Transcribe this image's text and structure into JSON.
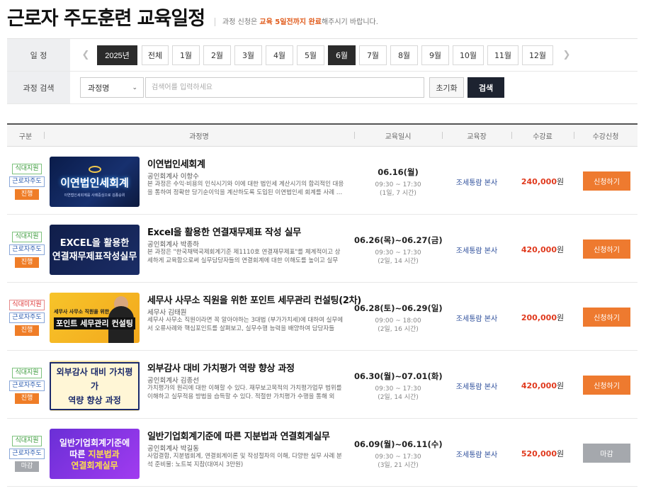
{
  "header": {
    "title": "근로자 주도훈련 교육일정",
    "notice_prefix": "과정 신청은 ",
    "notice_highlight": "교육 5일전까지 완료",
    "notice_suffix": "해주시기 바랍니다."
  },
  "filter": {
    "schedule_label": "일 정",
    "year": "2025년",
    "months": [
      "전체",
      "1월",
      "2월",
      "3월",
      "4월",
      "5월",
      "6월",
      "7월",
      "8월",
      "9월",
      "10월",
      "11월",
      "12월"
    ],
    "active_month": "6월",
    "search_label": "과정 검색",
    "select_value": "과정명",
    "search_placeholder": "검색어를 입력하세요",
    "reset_label": "초기화",
    "search_button": "검색"
  },
  "table": {
    "headers": [
      "구분",
      "과정명",
      "교육일시",
      "교육장",
      "수강료",
      "수강신청"
    ],
    "rows": [
      {
        "badges": [
          "식대지원",
          "근로자주도",
          "진행"
        ],
        "title": "이연법인세회계",
        "instructor": "공인회계사 이항수",
        "desc": "본 과정은 수익·비용의 인식시기와 이에 대한 법인세 계산시기의 합리적인 대응을 통하여 정확한 당기순이익을 계산하도록 도입된 이연법인세 회계를 사례 …",
        "thumb_main": "이연법인세회계",
        "thumb_sub": "이연법인세회계를 사례중심으로 김종승위",
        "date": "06.16(월)",
        "time": "09:30 ~ 17:30",
        "duration": "(1일, 7 시간)",
        "place": "조세통람 본사",
        "fee_num": "240,000",
        "fee_unit": "원",
        "apply": "신청하기"
      },
      {
        "badges": [
          "식대지원",
          "근로자주도",
          "진행"
        ],
        "title": "Excel을 활용한 연결재무제표 작성 실무",
        "instructor": "공인회계사 박종하",
        "desc": "본 과정은 \"한국채택국제회계기준 제1110호 연결재무제표\"를 체계적이고 상세하게 교육함으로써 실무담당자들의 연결회계에 대한 이해도를 높이고 실무처…",
        "thumb_line1": "EXCEL을 활용한",
        "thumb_line2": "연결재무제표작성실무",
        "date": "06.26(목)~06.27(금)",
        "time": "09:30 ~ 17:30",
        "duration": "(2일, 14 시간)",
        "place": "조세통람 본사",
        "fee_num": "420,000",
        "fee_unit": "원",
        "apply": "신청하기"
      },
      {
        "badges": [
          "식대미지원",
          "근로자주도",
          "진행"
        ],
        "title": "세무사 사무소 직원을 위한 포인트 세무관리 컨설팅(2차)",
        "instructor": "세무사 김태원",
        "desc": "세무사 사무소 직원이라면 꼭 알아야하는 3대법 (부가가치세)에 대하여 실무에서 오류사례와 핵심포인트를 살펴보고, 실무수행 능력을 배양하여 담당자들이…",
        "thumb_line0": "세무사 사무소  직원을 위한",
        "thumb_line1": "포인트 세무관리 컨설팅",
        "date": "06.28(토)~06.29(일)",
        "time": "09:00 ~ 18:00",
        "duration": "(2일, 16 시간)",
        "place": "조세통람 본사",
        "fee_num": "200,000",
        "fee_unit": "원",
        "apply": "신청하기"
      },
      {
        "badges": [
          "식대지원",
          "근로자주도",
          "진행"
        ],
        "title": "외부감사 대비 가치평가 역량 향상 과정",
        "instructor": "공인회계사 김종선",
        "desc": "가치평가의 원리에 대한 이해할 수 있다. 재무보고목적의 가치평가업무 범위를 이해하고 실무적용 방법을 습득할 수 있다. 적절한 가치평가 수행을 통해 외부…",
        "thumb_line1": "외부감사 대비 가치평가",
        "thumb_line2": "역량 향상 과정",
        "date": "06.30(월)~07.01(화)",
        "time": "09:30 ~ 17:30",
        "duration": "(2일, 14 시간)",
        "place": "조세통람 본사",
        "fee_num": "420,000",
        "fee_unit": "원",
        "apply": "신청하기"
      },
      {
        "badges": [
          "식대지원",
          "근로자주도",
          "마감"
        ],
        "title": "일반기업회계기준에 따른 지분법과 연결회계실무",
        "instructor": "공인회계사 박길동",
        "desc": "사업결합, 지분법회계, 연결회계이론 및 작성절차의 이해, 다양한 실무 사례 분석 준비물: 노트북 지참(대여시 3만원)",
        "thumb_line1": "일반기업회계기준에",
        "thumb_line2a": "따른 ",
        "thumb_line2b": "지분법과",
        "thumb_line3": "연결회계실무",
        "date": "06.09(월)~06.11(수)",
        "time": "09:30 ~ 17:30",
        "duration": "(3일, 21 시간)",
        "place": "조세통람 본사",
        "fee_num": "520,000",
        "fee_unit": "원",
        "apply": "마감"
      }
    ]
  },
  "colors": {
    "accent": "#ee7a2f",
    "dark": "#2b2b2b",
    "navy": "#1d2330",
    "link": "#2b4c9a",
    "fee": "#e03a1e"
  },
  "icons": {
    "prev": "chevron-left-icon",
    "next": "chevron-right-icon",
    "select": "chevron-down-icon"
  }
}
